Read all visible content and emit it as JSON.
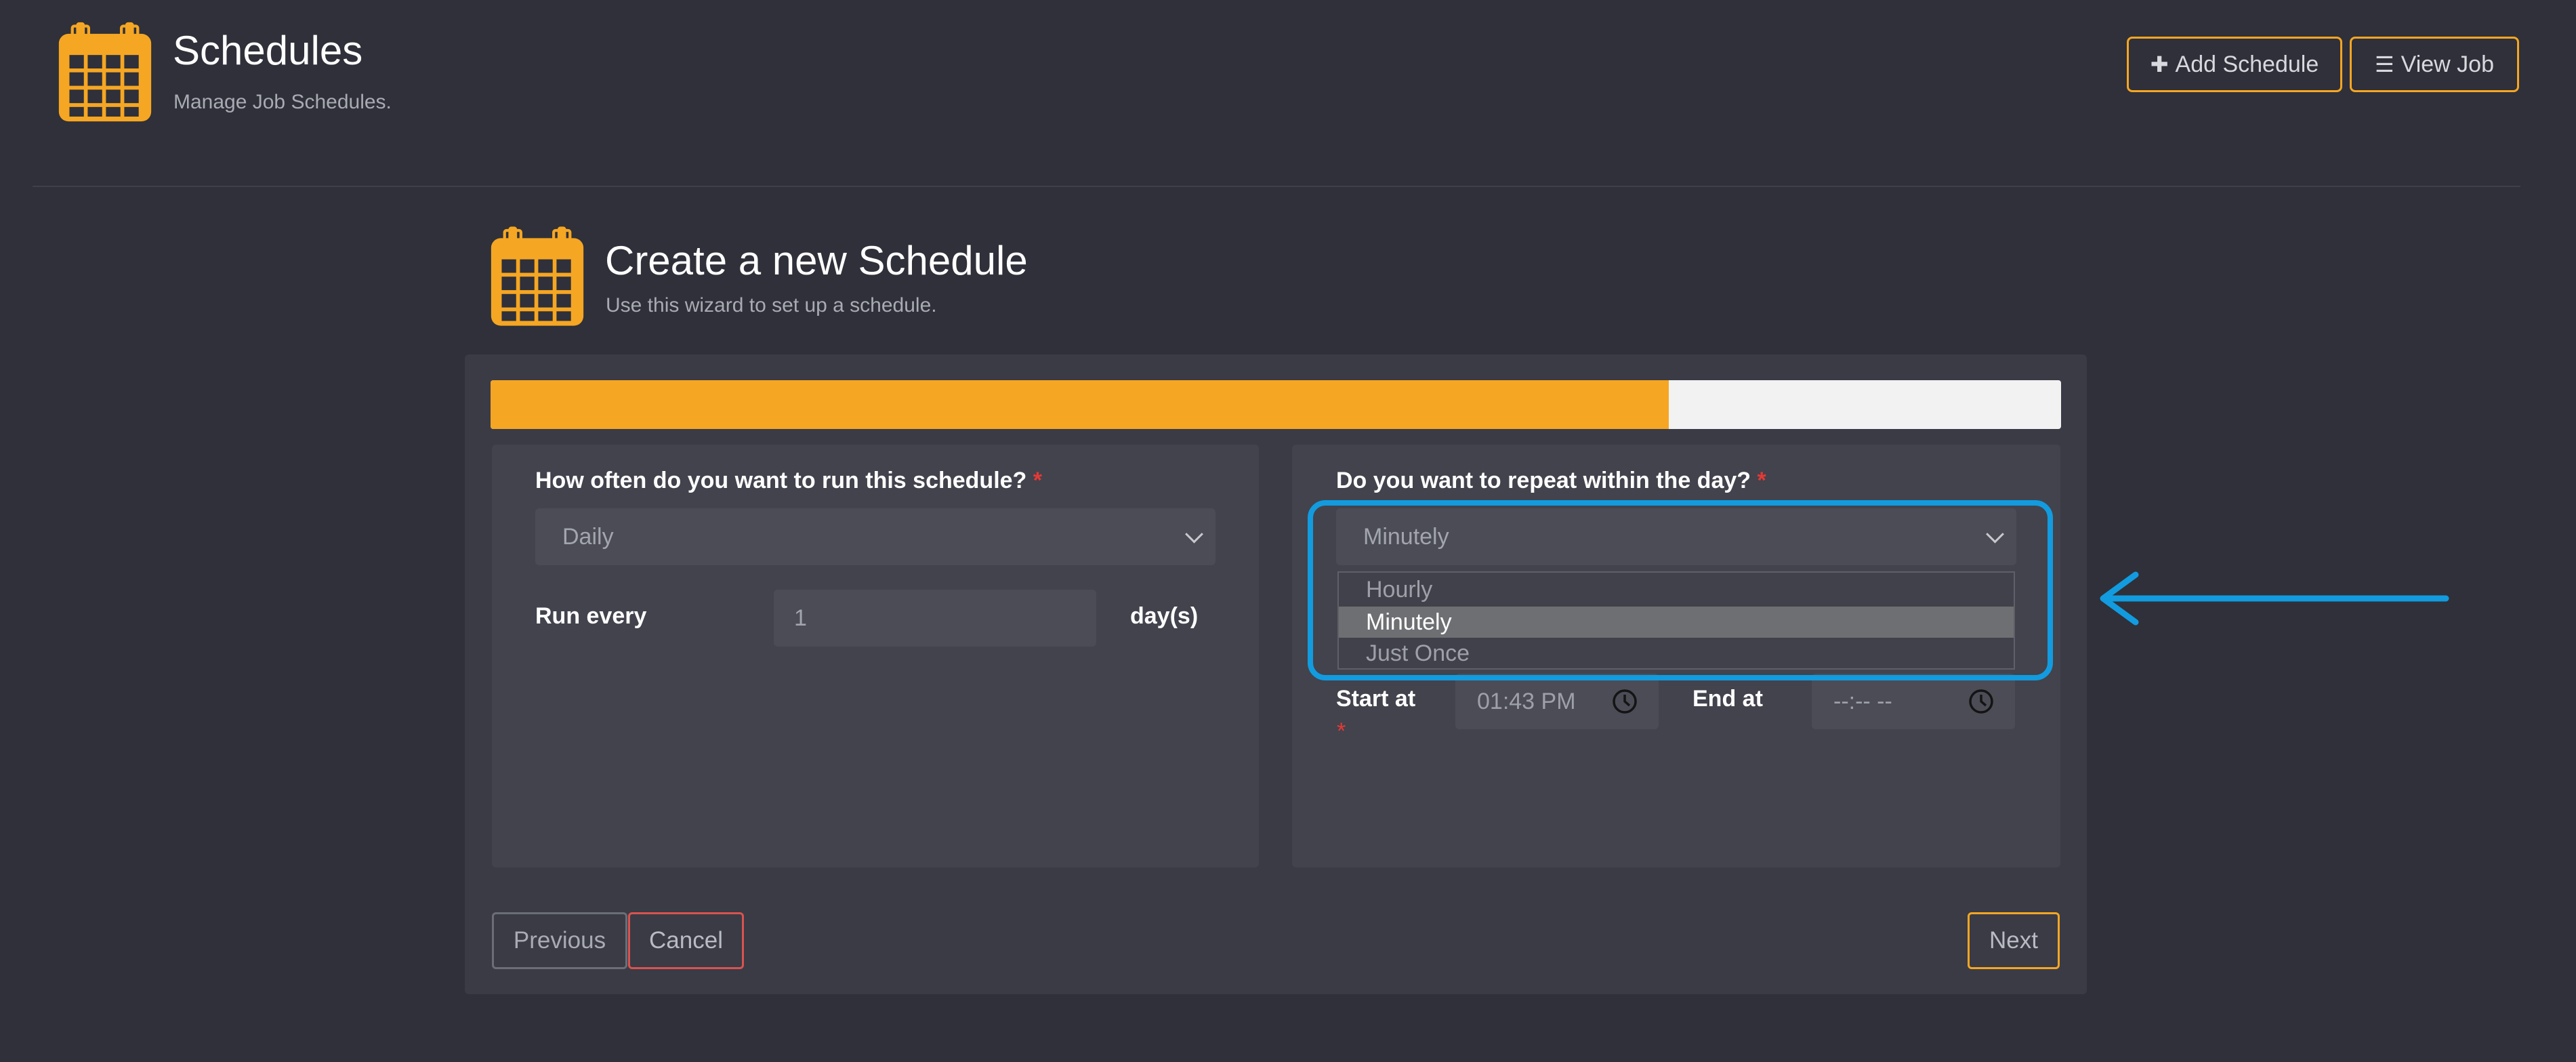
{
  "header": {
    "icon": "calendar-icon",
    "title": "Schedules",
    "subtitle": "Manage Job Schedules.",
    "add_schedule_label": "Add Schedule",
    "view_job_label": "View Job"
  },
  "wizard": {
    "icon": "calendar-icon",
    "title": "Create a new Schedule",
    "subtitle": "Use this wizard to set up a schedule.",
    "progress_fraction": 0.75
  },
  "left_panel": {
    "frequency_label": "How often do you want to run this schedule?",
    "required_mark": "*",
    "frequency_value": "Daily",
    "run_every_label": "Run every",
    "run_every_value": "1",
    "run_every_unit": "day(s)"
  },
  "right_panel": {
    "repeat_label": "Do you want to repeat within the day?",
    "required_mark": "*",
    "repeat_value": "Minutely",
    "options": [
      "Hourly",
      "Minutely",
      "Just Once"
    ],
    "selected_option": "Minutely",
    "start_label": "Start at",
    "start_required": "*",
    "start_value": "01:43 PM",
    "end_label": "End at",
    "end_value": "--:-- --"
  },
  "footer": {
    "previous_label": "Previous",
    "cancel_label": "Cancel",
    "next_label": "Next"
  },
  "colors": {
    "accent": "#f5a623",
    "danger": "#d9534f",
    "annotation": "#129bdf",
    "background": "#2f3039"
  }
}
